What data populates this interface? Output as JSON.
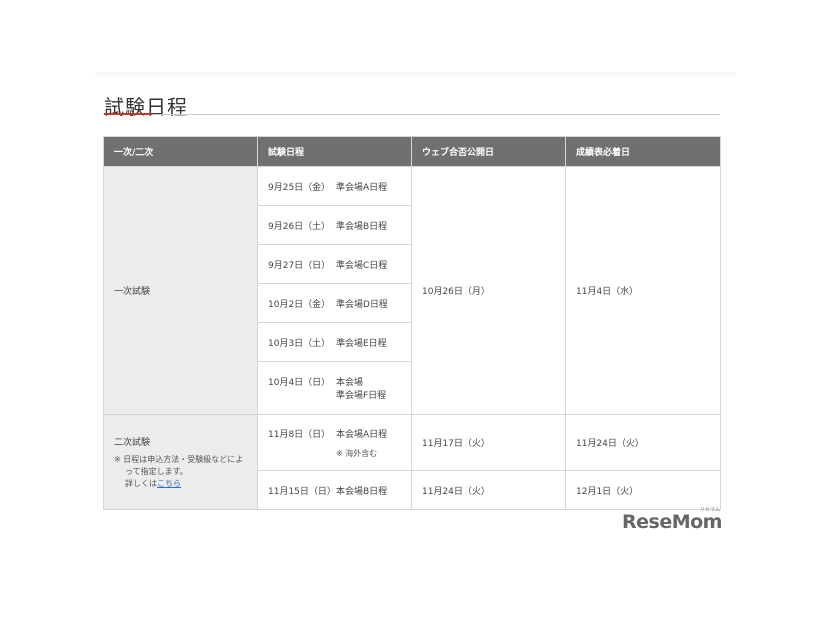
{
  "page_title": "試験日程",
  "table": {
    "headers": [
      "一次/二次",
      "試験日程",
      "ウェブ合否公開日",
      "成績表必着日"
    ],
    "first_exam": {
      "category": "一次試験",
      "schedules": [
        {
          "date": "9月25日（金）",
          "venue": "準会場A日程"
        },
        {
          "date": "9月26日（土）",
          "venue": "準会場B日程"
        },
        {
          "date": "9月27日（日）",
          "venue": "準会場C日程"
        },
        {
          "date": "10月2日（金）",
          "venue": "準会場D日程"
        },
        {
          "date": "10月3日（土）",
          "venue": "準会場E日程"
        },
        {
          "date": "10月4日（日）",
          "venue": "本会場",
          "venue2": "準会場F日程"
        }
      ],
      "web_result_date": "10月26日（月）",
      "score_report_date": "11月4日（水）"
    },
    "second_exam": {
      "category": "二次試験",
      "note_line1": "※ 日程は申込方法・受験級などによ",
      "note_line2": "って指定します。",
      "note_line3_prefix": "詳しくは",
      "note_link": "こちら",
      "rows": [
        {
          "date": "11月8日（日）",
          "venue": "本会場A日程",
          "note": "※ 海外含む",
          "web_result_date": "11月17日（火）",
          "score_report_date": "11月24日（火）"
        },
        {
          "date": "11月15日（日）",
          "venue": "本会場B日程",
          "web_result_date": "11月24日（火）",
          "score_report_date": "12月1日（火）"
        }
      ]
    }
  },
  "logo": {
    "text": "ReseMom",
    "kana": "リセマム"
  }
}
